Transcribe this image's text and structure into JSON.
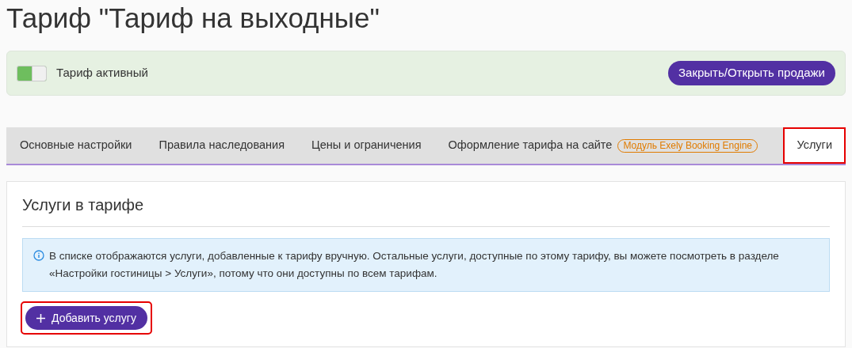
{
  "title": "Тариф \"Тариф на выходные\"",
  "status": {
    "label": "Тариф активный",
    "on": true,
    "button": "Закрыть/Открыть продажи"
  },
  "tabs": [
    {
      "label": "Основные настройки",
      "selected": false,
      "highlighted": false
    },
    {
      "label": "Правила наследования",
      "selected": false,
      "highlighted": false
    },
    {
      "label": "Цены и ограничения",
      "selected": false,
      "highlighted": false
    },
    {
      "label": "Оформление тарифа на сайте",
      "badge": "Модуль Exely Booking Engine",
      "selected": false,
      "highlighted": false
    },
    {
      "label": "Услуги",
      "selected": true,
      "highlighted": true
    }
  ],
  "section": {
    "title": "Услуги в тарифе",
    "info": "В списке отображаются услуги, добавленные к тарифу вручную. Остальные услуги, доступные по этому тарифу, вы можете посмотреть в разделе «Настройки гостиницы > Услуги», потому что они доступны по всем тарифам.",
    "add_button": {
      "label": "Добавить услугу",
      "highlighted": true
    }
  }
}
